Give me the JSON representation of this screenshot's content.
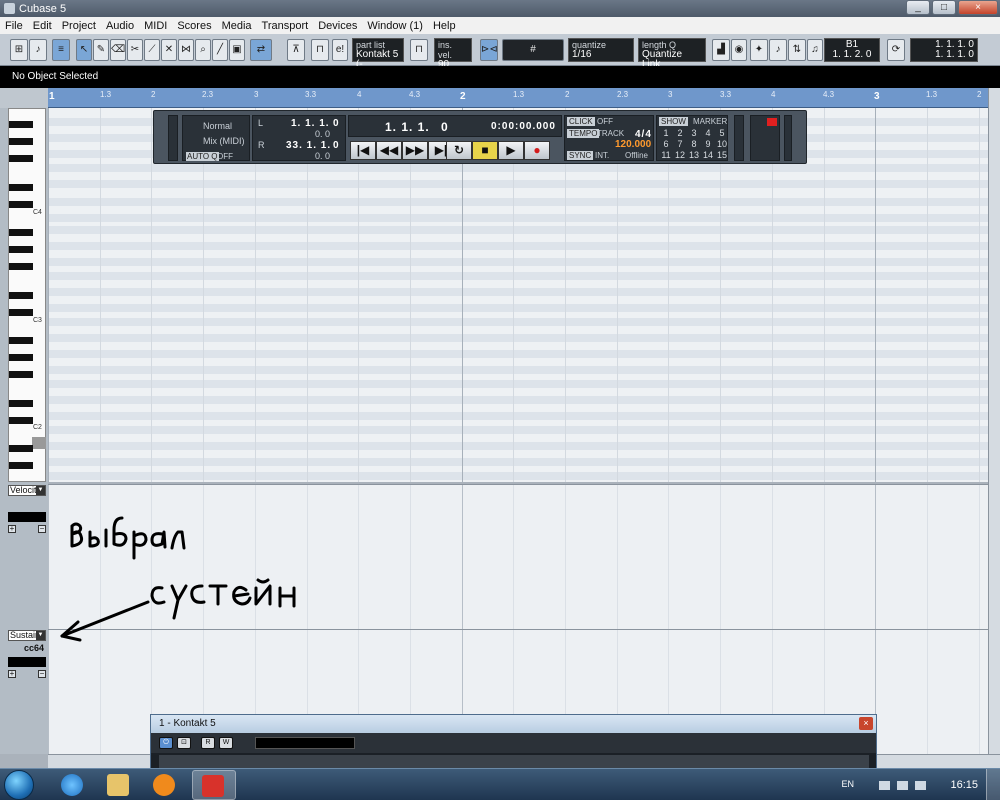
{
  "window": {
    "title": "Cubase 5",
    "controls": {
      "minimize": "_",
      "maximize": "□",
      "close": "×"
    }
  },
  "menu": [
    "File",
    "Edit",
    "Project",
    "Audio",
    "MIDI",
    "Scores",
    "Media",
    "Transport",
    "Devices",
    "Window (1)",
    "Help"
  ],
  "toolbar": {
    "part_list_label": "part list",
    "part_list_value": "Kontakt 5 (-",
    "ins_vel_label": "ins. vel.",
    "ins_vel_value": "90",
    "quantize_label": "quantize",
    "quantize_value": "1/16",
    "length_q_label": "length Q",
    "length_q_value": "Quantize Link",
    "b1_label": "B1",
    "pos_top": "1. 1. 1. 0",
    "pos_bottom": "1. 1. 2. 0",
    "pos2_top": "1. 1. 1. 0",
    "pos2_bottom": "1. 1. 1. 0"
  },
  "info_line": "No Object Selected",
  "ruler": {
    "major": [
      "1",
      "2",
      "3"
    ],
    "minor": [
      "1.3",
      "2",
      "2.3",
      "3",
      "3.3",
      "4",
      "4.3",
      "1.3",
      "2",
      "2.3",
      "3",
      "3.3",
      "4",
      "4.3",
      "1.3",
      "2"
    ]
  },
  "keyboard": {
    "labels": [
      "C4",
      "C3",
      "C2"
    ]
  },
  "lanes": {
    "velocity_label": "Velocit",
    "sustain_label": "Sustain",
    "sustain_cc": "cc64",
    "expand": "+",
    "collapse": "−"
  },
  "annotation": {
    "line1": "выбрал",
    "line2": "сустейн",
    "color": "#000000"
  },
  "transport": {
    "mode_normal": "Normal",
    "mode_mix": "Mix (MIDI)",
    "auto_q": "AUTO Q",
    "auto_q_state": "OFF",
    "left_locator": "1. 1. 1.",
    "left_locator_tick": "0",
    "left_sub": "0. 0",
    "right_locator": "33. 1. 1.",
    "right_locator_tick": "0",
    "right_sub": "0. 0",
    "primary_position": "1. 1. 1.",
    "primary_tick": "0",
    "secondary_time": "0:00:00.000",
    "click_label": "CLICK",
    "click_state": "OFF",
    "tempo_label": "TEMPO",
    "track_label": "TRACK",
    "signature": "4/4",
    "tempo": "120.000",
    "sync_label": "SYNC",
    "sync_source": "INT.",
    "sync_state": "Offline",
    "show_label": "SHOW",
    "marker_label": "MARKER",
    "markers": [
      "1",
      "2",
      "3",
      "4",
      "5",
      "6",
      "7",
      "8",
      "9",
      "10",
      "11",
      "12",
      "13",
      "14",
      "15"
    ],
    "buttons": [
      "|◀",
      "◀◀",
      "▶▶",
      "▶|",
      "↻",
      "■",
      "▶",
      "●"
    ],
    "accent": "#ff9a2e"
  },
  "kontakt": {
    "title": "1 - Kontakt 5",
    "close": "×",
    "buttons": [
      "⏻",
      "⊡",
      "R",
      "W"
    ]
  },
  "taskbar": {
    "language": "EN",
    "clock": "16:15"
  },
  "colors": {
    "ruler": "#6f97cb",
    "grid_bg": "#eef1f4",
    "transport_bg": "#4b5560",
    "stop_button": "#e8d44a",
    "record": "#d31c1c"
  }
}
